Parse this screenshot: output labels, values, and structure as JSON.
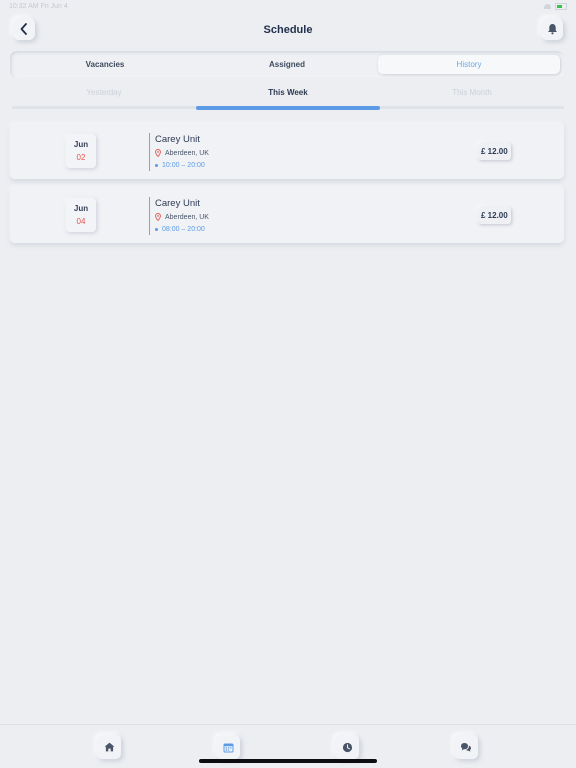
{
  "status_bar": {
    "time": "10:32 AM   Fri Jun 4"
  },
  "header": {
    "title": "Schedule"
  },
  "segments": {
    "items": [
      "Vacancies",
      "Assigned",
      "History"
    ],
    "active": "History"
  },
  "periods": {
    "items": [
      "Yesterday",
      "This Week",
      "This Month"
    ],
    "active": "This Week"
  },
  "shifts": [
    {
      "month": "Jun",
      "day": "02",
      "unit": "Carey Unit",
      "location": "Aberdeen, UK",
      "time": "10:00 – 20:00",
      "price": "£ 12.00"
    },
    {
      "month": "Jun",
      "day": "04",
      "unit": "Carey Unit",
      "location": "Aberdeen, UK",
      "time": "08:00 – 20:00",
      "price": "£ 12.00"
    }
  ],
  "colors": {
    "accent": "#5b9be6",
    "date_day": "#e0574f",
    "background": "#eceef2"
  },
  "nav_icons": [
    "home-icon",
    "calendar-icon",
    "clock-icon",
    "chat-icon"
  ]
}
